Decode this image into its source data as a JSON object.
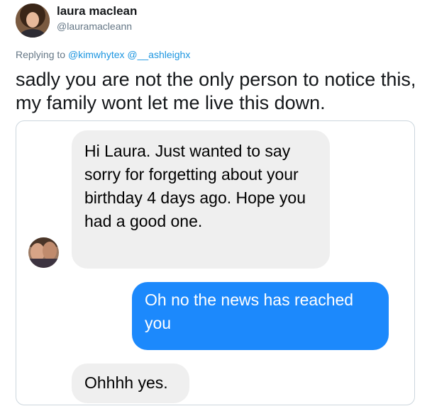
{
  "author": {
    "name": "laura maclean",
    "handle": "@lauramacleann",
    "avatar_icon": "profile-photo-icon"
  },
  "reply": {
    "prefix": "Replying to",
    "mentions": [
      "@kimwhytex",
      "@__ashleighx"
    ]
  },
  "tweet": {
    "text": "sadly you are not the only person to notice this, my family wont let me live this down."
  },
  "conversation": {
    "contact_avatar_icon": "contact-photo-icon",
    "messages": [
      {
        "from": "contact",
        "text": "Hi Laura.  Just wanted to say sorry for forgetting about your birthday 4 days ago. Hope you had a good one."
      },
      {
        "from": "me",
        "text": "Oh no the news has reached you"
      },
      {
        "from": "contact",
        "text": "Ohhhh yes."
      }
    ],
    "colors": {
      "incoming": "#efefef",
      "outgoing": "#1c89fc"
    }
  }
}
